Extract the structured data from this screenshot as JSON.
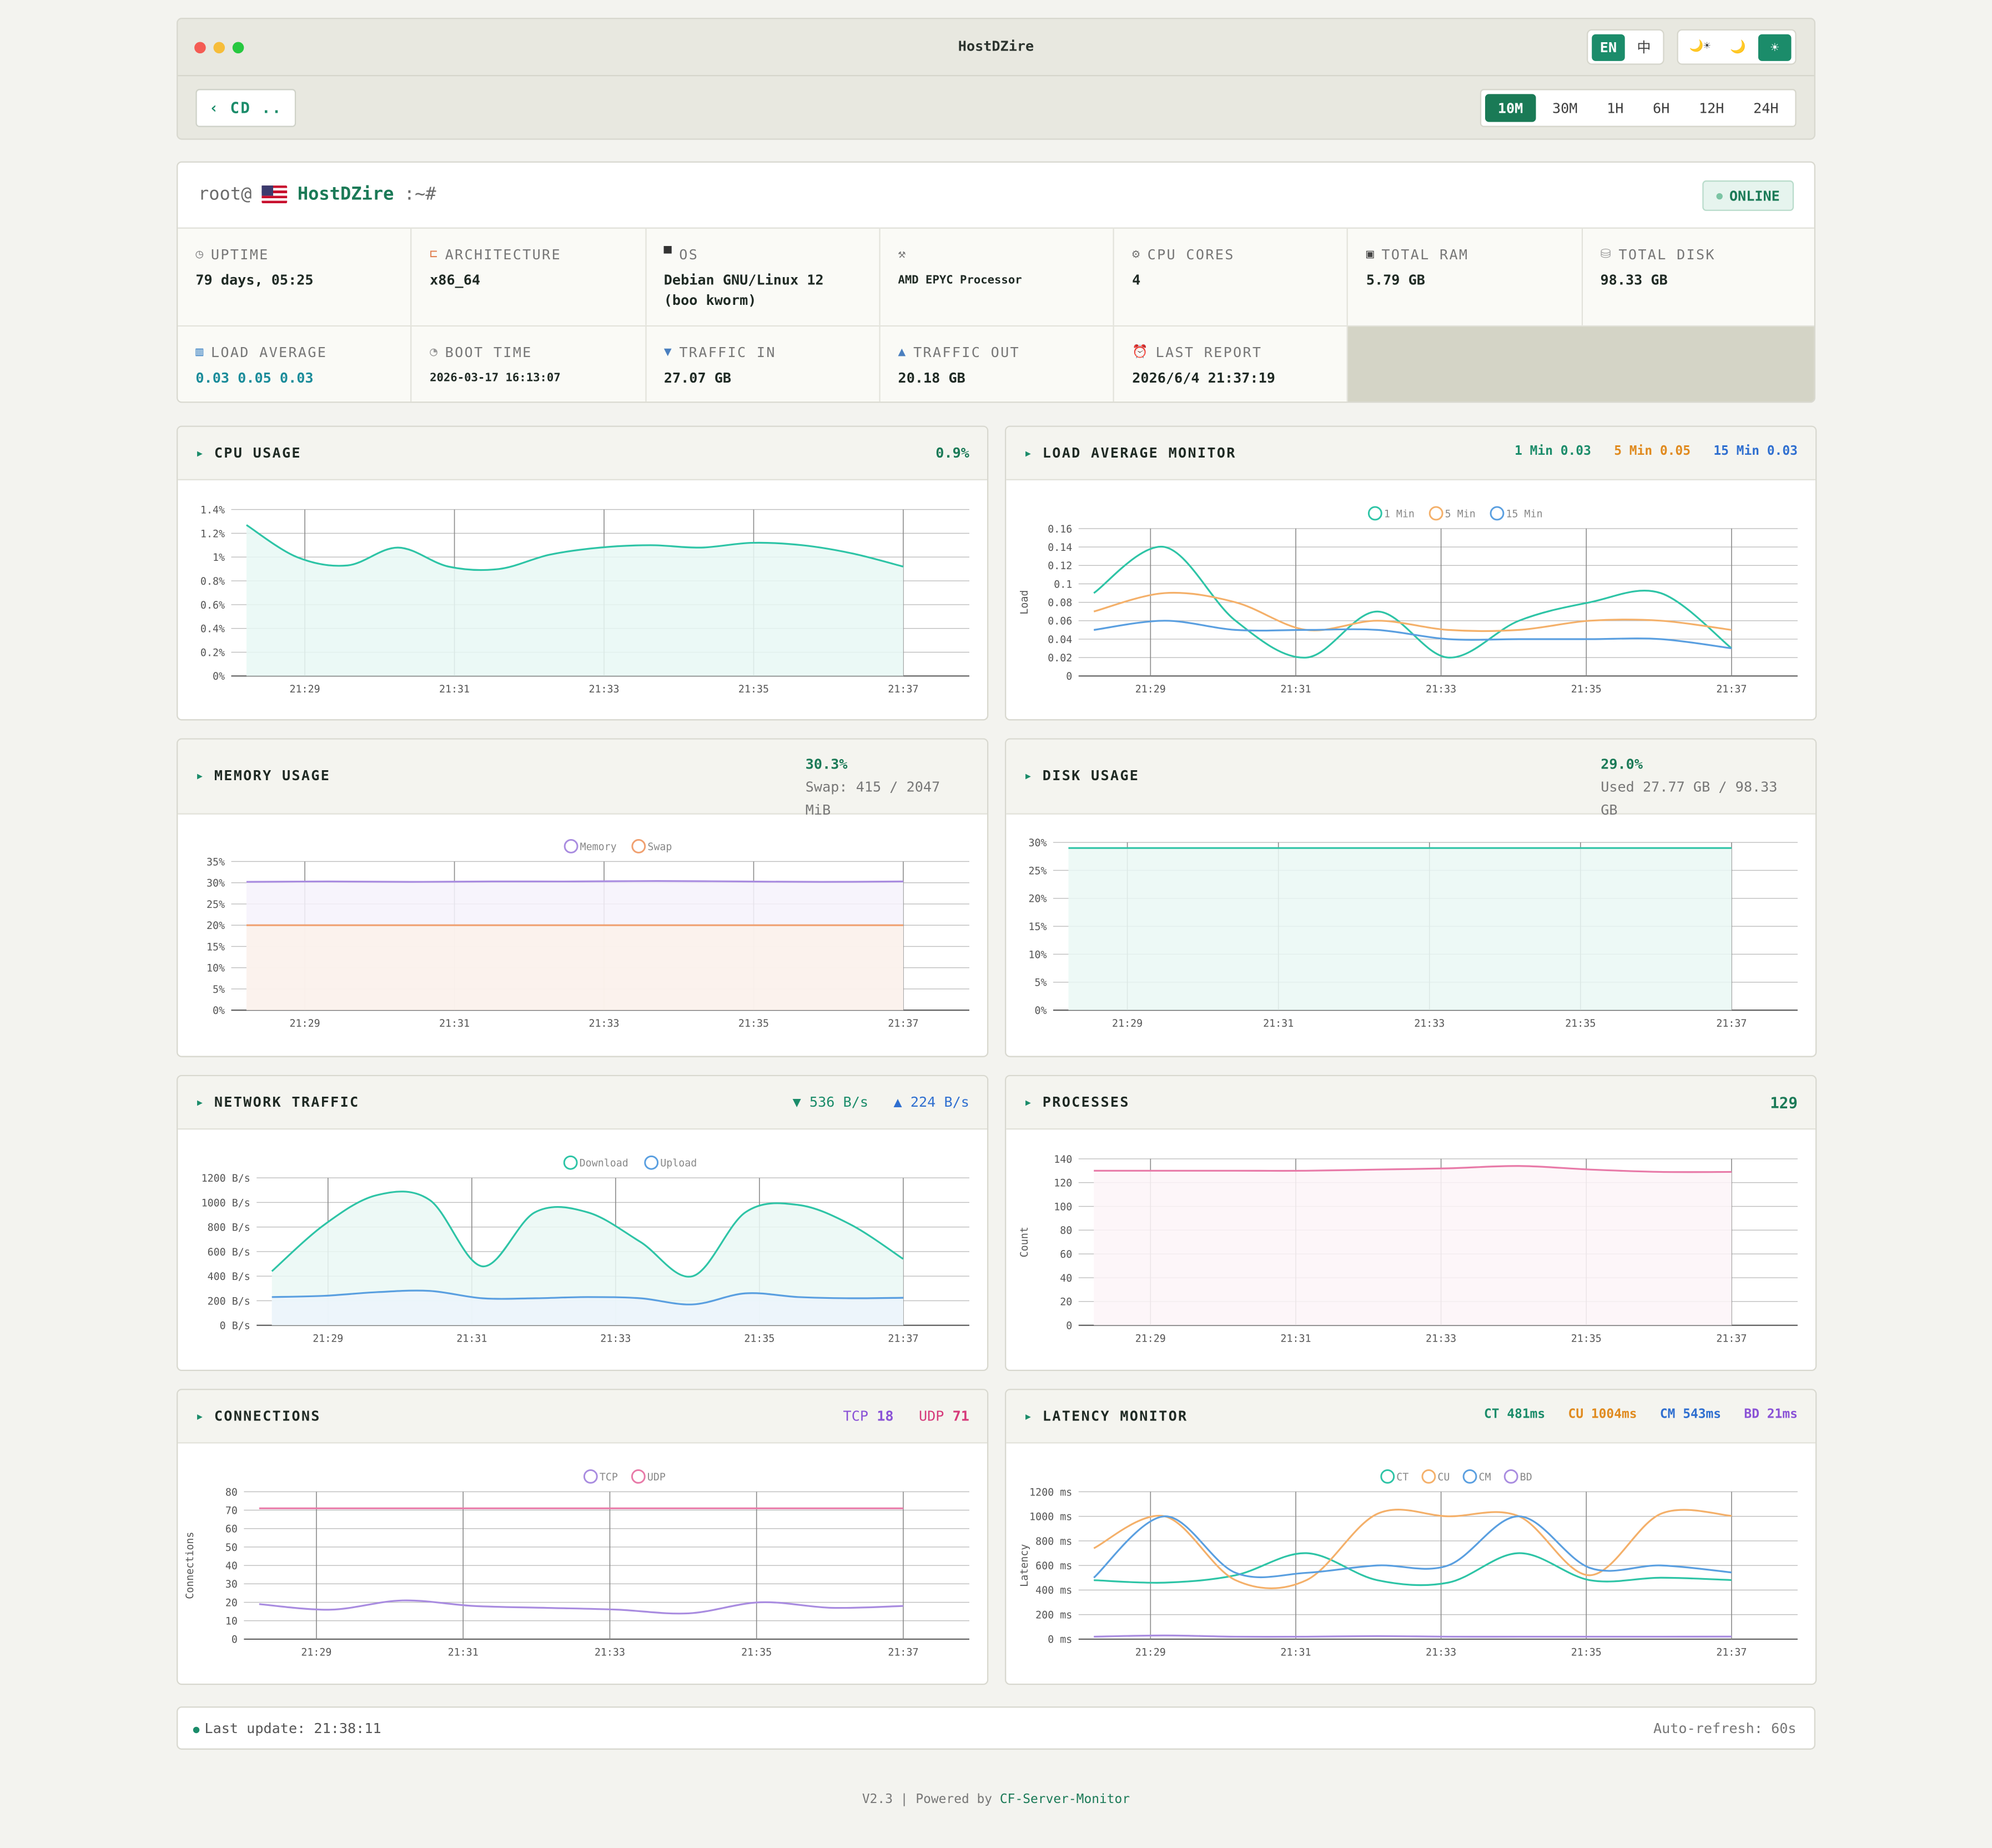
{
  "window": {
    "title": "HostDZire"
  },
  "lang": {
    "en": "EN",
    "zh": "中",
    "active": "EN"
  },
  "theme": {
    "auto": "🌙☀",
    "dark": "🌙",
    "light": "☀",
    "active": "light"
  },
  "nav": {
    "back_label": "‹ CD .."
  },
  "time_ranges": {
    "items": [
      "10M",
      "30M",
      "1H",
      "6H",
      "12H",
      "24H"
    ],
    "active": "10M"
  },
  "host": {
    "prompt_prefix": "root@",
    "hostname": "HostDZire",
    "prompt_suffix": ":~#",
    "status": "ONLINE"
  },
  "info": [
    {
      "label": "UPTIME",
      "value": "79 days, 05:25",
      "icon": "clock-icon",
      "color": "#888888"
    },
    {
      "label": "ARCHITECTURE",
      "value": "x86_64",
      "icon": "architecture-icon",
      "color": "#e07c4c"
    },
    {
      "label": "OS",
      "value": "Debian GNU/Linux 12 (boo kworm)",
      "icon": "monitor-icon",
      "color": "#333333"
    },
    {
      "label": "",
      "value": "AMD EPYC Processor",
      "icon": "wrench-icon",
      "color": "#777777"
    },
    {
      "label": "CPU CORES",
      "value": "4",
      "icon": "gear-icon",
      "color": "#777777"
    },
    {
      "label": "TOTAL RAM",
      "value": "5.79 GB",
      "icon": "floppy-icon",
      "color": "#444444"
    },
    {
      "label": "TOTAL DISK",
      "value": "98.33 GB",
      "icon": "disk-icon",
      "color": "#999999"
    },
    {
      "label": "LOAD AVERAGE",
      "value": "0.03 0.05 0.03",
      "icon": "bar-chart-icon",
      "color": "#3b82c4"
    },
    {
      "label": "BOOT TIME",
      "value": "2026-03-17 16:13:07",
      "icon": "clock-face-icon",
      "color": "#999999"
    },
    {
      "label": "TRAFFIC IN",
      "value": "27.07 GB",
      "icon": "download-arrow-icon",
      "color": "#4a7fbf"
    },
    {
      "label": "TRAFFIC OUT",
      "value": "20.18 GB",
      "icon": "upload-arrow-icon",
      "color": "#4a7fbf"
    },
    {
      "label": "LAST REPORT",
      "value": "2026/6/4 21:37:19",
      "icon": "alarm-clock-icon",
      "color": "#d9534f"
    }
  ],
  "panels": {
    "cpu": {
      "title": "CPU USAGE",
      "stat": "0.9%"
    },
    "load": {
      "title": "LOAD AVERAGE MONITOR",
      "s1": "1 Min 0.03",
      "s5": "5 Min 0.05",
      "s15": "15 Min 0.03"
    },
    "memory": {
      "title": "MEMORY USAGE",
      "stat": "30.3%",
      "sub": "Swap: 415 / 2047 MiB"
    },
    "disk": {
      "title": "DISK USAGE",
      "stat": "29.0%",
      "sub": "Used 27.77 GB / 98.33 GB"
    },
    "network": {
      "title": "NETWORK TRAFFIC",
      "down": "▼ 536 B/s",
      "up": "▲ 224 B/s"
    },
    "processes": {
      "title": "PROCESSES",
      "stat": "129"
    },
    "connections": {
      "title": "CONNECTIONS",
      "tcp_label": "TCP",
      "tcp": "18",
      "udp_label": "UDP",
      "udp": "71"
    },
    "latency": {
      "title": "LATENCY MONITOR",
      "ct": "CT 481ms",
      "cu": "CU 1004ms",
      "cm": "CM 543ms",
      "bd": "BD 21ms"
    }
  },
  "chart_data": [
    {
      "id": "cpu",
      "type": "area",
      "x": [
        "21:29",
        "21:31",
        "21:33",
        "21:35",
        "21:37"
      ],
      "ylim": [
        0,
        1.4
      ],
      "yticks": [
        "0%",
        "0.2%",
        "0.4%",
        "0.6%",
        "0.8%",
        "1%",
        "1.2%",
        "1.4%"
      ],
      "ylabel": "",
      "series": [
        {
          "name": "",
          "color": "#2ec4a6",
          "fill": "#e8f8f4",
          "values": [
            1.27,
            1.0,
            0.93,
            1.08,
            0.92,
            0.9,
            1.02,
            1.08,
            1.1,
            1.08,
            1.12,
            1.1,
            1.03,
            0.92
          ]
        }
      ]
    },
    {
      "id": "load",
      "type": "line",
      "x": [
        "21:29",
        "21:31",
        "21:33",
        "21:35",
        "21:37"
      ],
      "ylim": [
        0,
        0.16
      ],
      "yticks": [
        "0",
        "0.02",
        "0.04",
        "0.06",
        "0.08",
        "0.1",
        "0.12",
        "0.14",
        "0.16"
      ],
      "ylabel": "Load",
      "series": [
        {
          "name": "1 Min",
          "color": "#2ec4a6",
          "values": [
            0.09,
            0.14,
            0.06,
            0.02,
            0.07,
            0.02,
            0.06,
            0.08,
            0.09,
            0.03
          ]
        },
        {
          "name": "5 Min",
          "color": "#f4b06a",
          "values": [
            0.07,
            0.09,
            0.08,
            0.05,
            0.06,
            0.05,
            0.05,
            0.06,
            0.06,
            0.05
          ]
        },
        {
          "name": "15 Min",
          "color": "#5a9fe0",
          "values": [
            0.05,
            0.06,
            0.05,
            0.05,
            0.05,
            0.04,
            0.04,
            0.04,
            0.04,
            0.03
          ]
        }
      ]
    },
    {
      "id": "memory",
      "type": "area",
      "x": [
        "21:29",
        "21:31",
        "21:33",
        "21:35",
        "21:37"
      ],
      "ylim": [
        0,
        35
      ],
      "yticks": [
        "0%",
        "5%",
        "10%",
        "15%",
        "20%",
        "25%",
        "30%",
        "35%"
      ],
      "ylabel": "",
      "series": [
        {
          "name": "Memory",
          "color": "#a98ce0",
          "fill": "#f6f2fc",
          "values": [
            30.2,
            30.3,
            30.2,
            30.3,
            30.3,
            30.4,
            30.3,
            30.2,
            30.3
          ]
        },
        {
          "name": "Swap",
          "color": "#f0a070",
          "fill": "#fbf1ea",
          "values": [
            20.0,
            20.0,
            20.0,
            20.0,
            20.0,
            20.0,
            20.0,
            20.0,
            20.0
          ]
        }
      ]
    },
    {
      "id": "disk",
      "type": "area",
      "x": [
        "21:29",
        "21:31",
        "21:33",
        "21:35",
        "21:37"
      ],
      "ylim": [
        0,
        30
      ],
      "yticks": [
        "0%",
        "5%",
        "10%",
        "15%",
        "20%",
        "25%",
        "30%"
      ],
      "ylabel": "",
      "series": [
        {
          "name": "",
          "color": "#2ec4a6",
          "fill": "#eaf8f4",
          "values": [
            29.0,
            29.0,
            29.0,
            29.0,
            29.0,
            29.0
          ]
        }
      ]
    },
    {
      "id": "network",
      "type": "area",
      "x": [
        "21:29",
        "21:31",
        "21:33",
        "21:35",
        "21:37"
      ],
      "ylim": [
        0,
        1200
      ],
      "yticks": [
        "0 B/s",
        "200 B/s",
        "400 B/s",
        "600 B/s",
        "800 B/s",
        "1000 B/s",
        "1200 B/s"
      ],
      "ylabel": "",
      "series": [
        {
          "name": "Download",
          "color": "#2ec4a6",
          "fill": "#eaf8f4",
          "values": [
            440,
            820,
            1060,
            1020,
            480,
            920,
            920,
            680,
            400,
            920,
            980,
            820,
            540
          ]
        },
        {
          "name": "Upload",
          "color": "#5a9fe0",
          "fill": "#ecf4fc",
          "values": [
            230,
            240,
            270,
            280,
            220,
            220,
            230,
            220,
            170,
            260,
            230,
            220,
            224
          ]
        }
      ]
    },
    {
      "id": "processes",
      "type": "area",
      "x": [
        "21:29",
        "21:31",
        "21:33",
        "21:35",
        "21:37"
      ],
      "ylim": [
        0,
        140
      ],
      "yticks": [
        "0",
        "20",
        "40",
        "60",
        "80",
        "100",
        "120",
        "140"
      ],
      "ylabel": "Count",
      "series": [
        {
          "name": "",
          "color": "#e87aa8",
          "fill": "#fdf4f8",
          "values": [
            130,
            130,
            130,
            130,
            131,
            132,
            134,
            131,
            129,
            129
          ]
        }
      ]
    },
    {
      "id": "connections",
      "type": "line",
      "x": [
        "21:29",
        "21:31",
        "21:33",
        "21:35",
        "21:37"
      ],
      "ylim": [
        0,
        80
      ],
      "yticks": [
        "0",
        "10",
        "20",
        "30",
        "40",
        "50",
        "60",
        "70",
        "80"
      ],
      "ylabel": "Connections",
      "series": [
        {
          "name": "TCP",
          "color": "#a98ce0",
          "values": [
            19,
            16,
            21,
            18,
            17,
            16,
            14,
            20,
            17,
            18
          ]
        },
        {
          "name": "UDP",
          "color": "#e87aa8",
          "values": [
            71,
            71,
            71,
            71,
            71,
            71,
            71,
            71,
            71,
            71
          ]
        }
      ]
    },
    {
      "id": "latency",
      "type": "line",
      "x": [
        "21:29",
        "21:31",
        "21:33",
        "21:35",
        "21:37"
      ],
      "ylim": [
        0,
        1200
      ],
      "yticks": [
        "0 ms",
        "200 ms",
        "400 ms",
        "600 ms",
        "800 ms",
        "1000 ms",
        "1200 ms"
      ],
      "ylabel": "Latency",
      "series": [
        {
          "name": "CT",
          "color": "#2ec4a6",
          "values": [
            480,
            460,
            520,
            700,
            480,
            460,
            700,
            480,
            500,
            481
          ]
        },
        {
          "name": "CU",
          "color": "#f4b06a",
          "values": [
            740,
            1000,
            480,
            480,
            1020,
            1000,
            1000,
            520,
            1020,
            1004
          ]
        },
        {
          "name": "CM",
          "color": "#5a9fe0",
          "values": [
            500,
            1000,
            540,
            540,
            600,
            600,
            1000,
            580,
            600,
            543
          ]
        },
        {
          "name": "BD",
          "color": "#a98ce0",
          "values": [
            20,
            30,
            20,
            20,
            25,
            20,
            20,
            20,
            20,
            21
          ]
        }
      ]
    }
  ],
  "status": {
    "last_update": "Last update: 21:38:11",
    "auto_refresh": "Auto-refresh: 60s"
  },
  "footer": {
    "version": "V2.3 | Powered by",
    "link": "CF-Server-Monitor"
  }
}
